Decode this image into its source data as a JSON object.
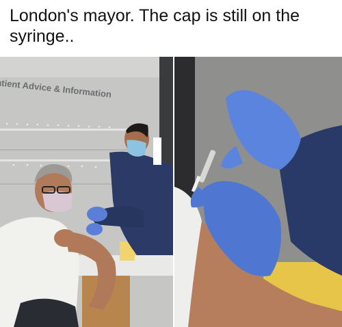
{
  "caption": "London's mayor. The cap is still on the syringe..",
  "left_photo": {
    "wall_sign": "atient Advice & Information"
  }
}
